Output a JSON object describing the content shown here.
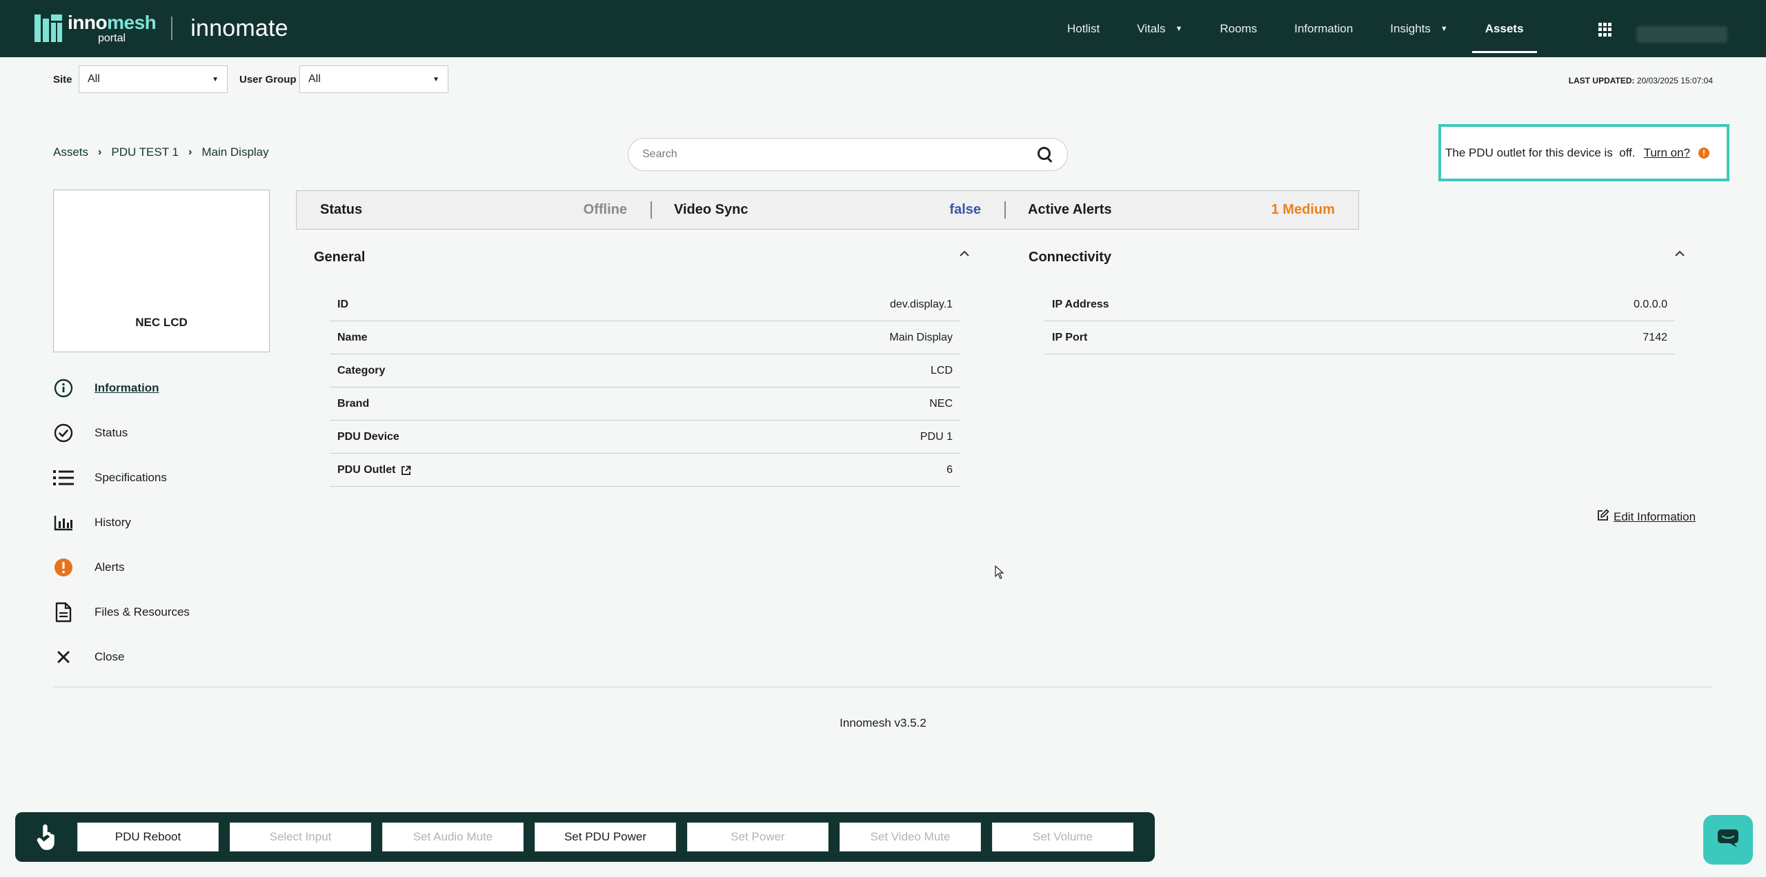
{
  "brand": {
    "logo_part1": "inno",
    "logo_part2": "mesh",
    "logo_sub": "portal",
    "app_name": "innomate"
  },
  "nav": {
    "items": [
      {
        "label": "Hotlist",
        "has_caret": false
      },
      {
        "label": "Vitals",
        "has_caret": true
      },
      {
        "label": "Rooms",
        "has_caret": false
      },
      {
        "label": "Information",
        "has_caret": false
      },
      {
        "label": "Insights",
        "has_caret": true
      },
      {
        "label": "Assets",
        "has_caret": false,
        "active": true
      }
    ],
    "apps_icon": "grid-icon"
  },
  "filters": {
    "site_label": "Site",
    "site_value": "All",
    "user_group_label": "User Group",
    "user_group_value": "All"
  },
  "last_updated": {
    "label": "LAST UPDATED:",
    "value": "20/03/2025 15:07:04"
  },
  "breadcrumb": [
    "Assets",
    "PDU TEST 1",
    "Main Display"
  ],
  "search": {
    "placeholder": "Search"
  },
  "pdu_notice": {
    "text": "The PDU outlet for this device is  off.",
    "action": "Turn on?",
    "warn_glyph": "!"
  },
  "device": {
    "model": "NEC LCD"
  },
  "side_menu": [
    {
      "label": "Information",
      "icon": "info-icon",
      "active": true
    },
    {
      "label": "Status",
      "icon": "check-circle-icon"
    },
    {
      "label": "Specifications",
      "icon": "list-icon"
    },
    {
      "label": "History",
      "icon": "bar-chart-icon"
    },
    {
      "label": "Alerts",
      "icon": "alert-icon"
    },
    {
      "label": "Files & Resources",
      "icon": "file-icon"
    },
    {
      "label": "Close",
      "icon": "close-icon"
    }
  ],
  "status_bar": {
    "status_label": "Status",
    "status_value": "Offline",
    "video_sync_label": "Video Sync",
    "video_sync_value": "false",
    "alerts_label": "Active Alerts",
    "alerts_value": "1 Medium"
  },
  "general": {
    "title": "General",
    "rows": [
      {
        "label": "ID",
        "value": "dev.display.1"
      },
      {
        "label": "Name",
        "value": "Main Display"
      },
      {
        "label": "Category",
        "value": "LCD"
      },
      {
        "label": "Brand",
        "value": "NEC"
      },
      {
        "label": "PDU Device",
        "value": "PDU 1"
      },
      {
        "label": "PDU Outlet",
        "value": "6",
        "link": true
      }
    ]
  },
  "connectivity": {
    "title": "Connectivity",
    "rows": [
      {
        "label": "IP Address",
        "value": "0.0.0.0"
      },
      {
        "label": "IP Port",
        "value": "7142"
      }
    ]
  },
  "edit_information": "Edit Information",
  "version": "Innomesh v3.5.2",
  "actions": [
    {
      "label": "PDU Reboot",
      "enabled": true
    },
    {
      "label": "Select Input",
      "enabled": false
    },
    {
      "label": "Set Audio Mute",
      "enabled": false
    },
    {
      "label": "Set PDU Power",
      "enabled": true
    },
    {
      "label": "Set Power",
      "enabled": false
    },
    {
      "label": "Set Video Mute",
      "enabled": false
    },
    {
      "label": "Set Volume",
      "enabled": false
    }
  ],
  "colors": {
    "nav_bg": "#123430",
    "accent": "#3cc9bd",
    "alert_orange": "#e8821a",
    "link_blue": "#3a56a8"
  }
}
